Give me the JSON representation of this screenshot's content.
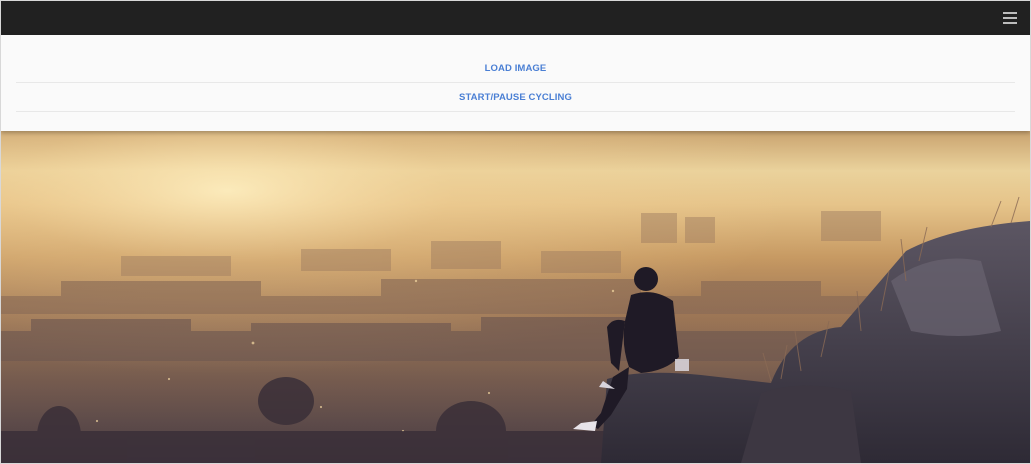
{
  "header": {
    "menu_icon": "hamburger-menu-icon"
  },
  "controls": {
    "load_label": "LOAD IMAGE",
    "cycle_label": "START/PAUSE CYCLING"
  },
  "image": {
    "subject": "silhouette of a person sitting on a rock overlooking a hazy city at sunset"
  },
  "colors": {
    "topbar": "#212121",
    "panel": "#fafafa",
    "button_text": "#4a7fd4"
  }
}
